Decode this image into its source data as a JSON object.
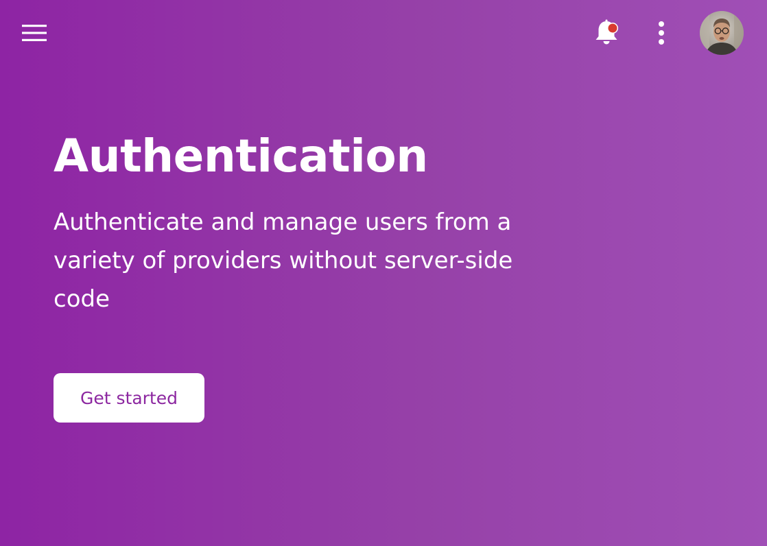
{
  "header": {
    "menu_icon": "hamburger-menu-icon",
    "notifications_icon": "bell-icon",
    "notification_dot_color": "#d83b2f",
    "more_icon": "more-vert-icon",
    "avatar": "user-avatar"
  },
  "hero": {
    "title": "Authentication",
    "description": "Authenticate and manage users from a variety of providers without server-side code",
    "cta_label": "Get started"
  },
  "colors": {
    "background_gradient_start": "#8e24a4",
    "background_gradient_end": "#a04fb6",
    "cta_text": "#8c27a0",
    "cta_background": "#ffffff"
  }
}
